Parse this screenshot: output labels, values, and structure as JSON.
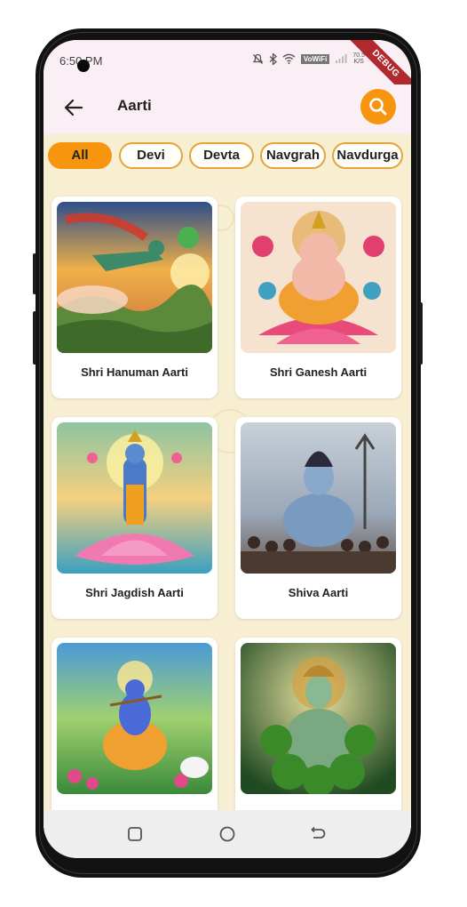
{
  "status_bar": {
    "time": "6:50 PM",
    "volte_label": "VoWiFi",
    "speed_value": "70.5",
    "speed_unit": "K/S",
    "debug_banner": "DEBUG"
  },
  "app_bar": {
    "title": "Aarti",
    "back_icon": "arrow-left-icon",
    "search_icon": "search-icon",
    "accent_color": "#f7950f"
  },
  "categories": [
    {
      "label": "All",
      "selected": true
    },
    {
      "label": "Devi",
      "selected": false
    },
    {
      "label": "Devta",
      "selected": false
    },
    {
      "label": "Navgrah",
      "selected": false
    },
    {
      "label": "Navdurga",
      "selected": false
    }
  ],
  "aartis": [
    {
      "title": "Shri Hanuman Aarti"
    },
    {
      "title": "Shri Ganesh Aarti"
    },
    {
      "title": "Shri Jagdish Aarti"
    },
    {
      "title": "Shiva Aarti"
    },
    {
      "title": ""
    },
    {
      "title": ""
    }
  ],
  "nav_bar": {
    "icons": [
      "recent-apps-icon",
      "home-icon",
      "back-icon"
    ]
  }
}
